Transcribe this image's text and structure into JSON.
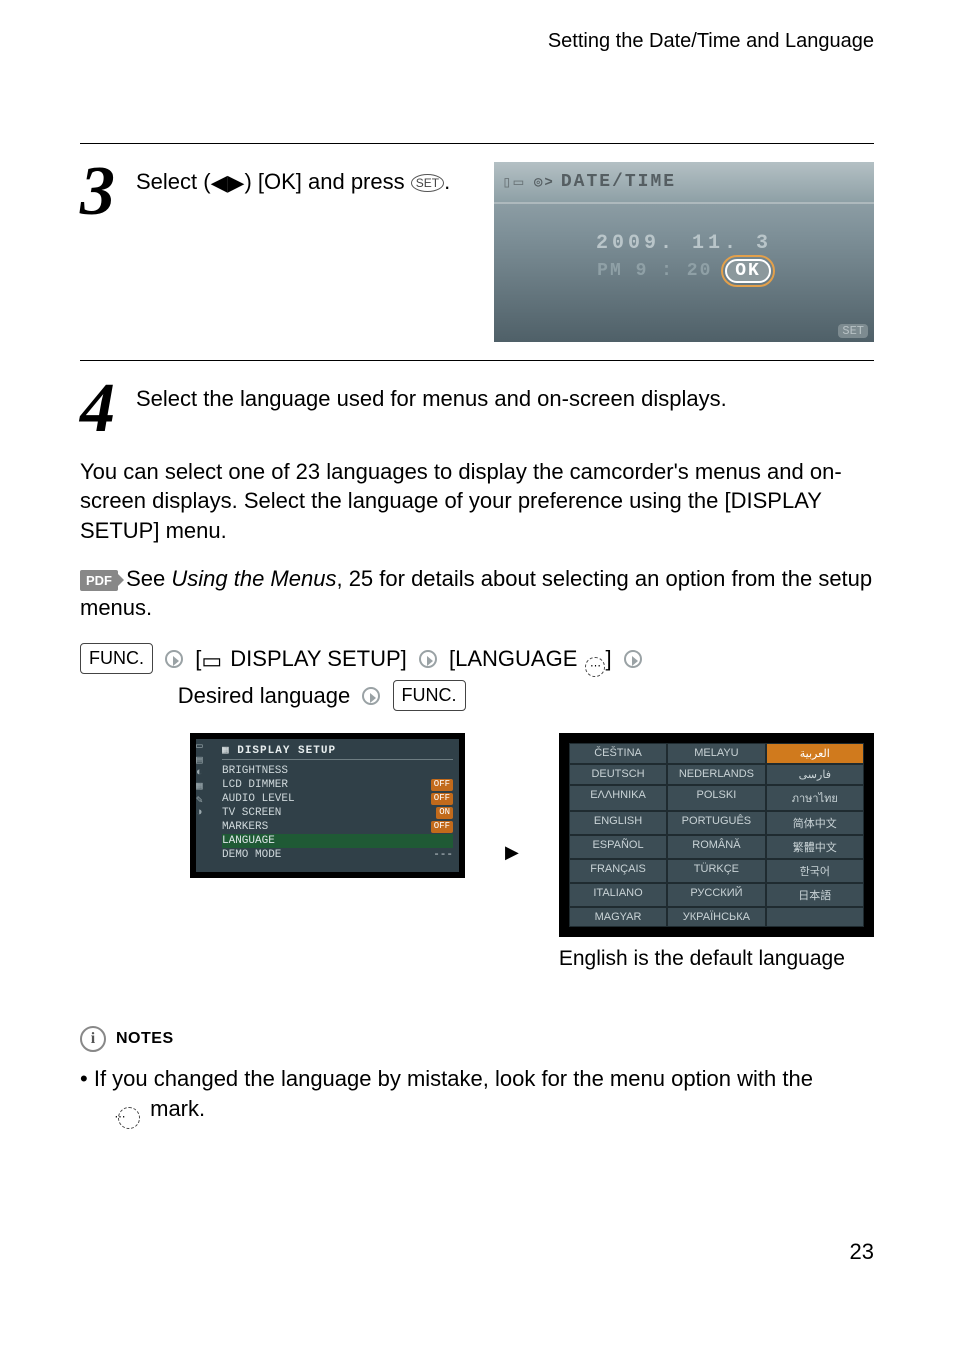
{
  "header": {
    "section_title": "Setting the Date/Time and Language"
  },
  "step3": {
    "number": "3",
    "text_pre": "Select (",
    "text_mid": ") [OK] and press ",
    "text_post": ".",
    "set_label": "SET",
    "lcd": {
      "breadcrumb": "DATE/TIME",
      "date": "2009. 11.  3",
      "time_prefix": "PM  9 : 20",
      "ok": "OK",
      "set_corner": "SET"
    }
  },
  "step4": {
    "number": "4",
    "text": "Select the language used for menus and on-screen displays."
  },
  "para1": "You can select one of 23 languages to display the camcorder's menus and on-screen displays. Select the language of your preference using the [DISPLAY SETUP] menu.",
  "pdf_line": {
    "badge": "PDF",
    "pre": " See ",
    "link": "Using the Menus",
    "post": ", 25 for details about selecting an option from the setup menus."
  },
  "menu_path": {
    "func": "FUNC.",
    "display_setup": " DISPLAY SETUP]",
    "language": "[LANGUAGE ",
    "lang_close": "]",
    "desired": "Desired language"
  },
  "lcd2": {
    "title": "DISPLAY SETUP",
    "rows": [
      {
        "label": "BRIGHTNESS",
        "val": ""
      },
      {
        "label": "LCD DIMMER",
        "val": "OFF"
      },
      {
        "label": "AUDIO LEVEL",
        "val": "OFF"
      },
      {
        "label": "TV SCREEN",
        "val": "ON"
      },
      {
        "label": "MARKERS",
        "val": "OFF"
      },
      {
        "label": "LANGUAGE",
        "val": "",
        "hl": true
      },
      {
        "label": "DEMO MODE",
        "val": "---"
      }
    ]
  },
  "languages": [
    "ČEŠTINA",
    "MELAYU",
    "العربية",
    "DEUTSCH",
    "NEDERLANDS",
    "فارسی",
    "ΕΛΛΗΝΙΚΑ",
    "POLSKI",
    "ภาษาไทย",
    "ENGLISH",
    "PORTUGUÊS",
    "简体中文",
    "ESPAÑOL",
    "ROMÂNĂ",
    "繁體中文",
    "FRANÇAIS",
    "TÜRKÇE",
    "한국어",
    "ITALIANO",
    "РУССКИЙ",
    "日本語",
    "MAGYAR",
    "УКРАЇНСЬКА",
    ""
  ],
  "caption": "English is the default language",
  "notes": {
    "title": "NOTES",
    "bullet1_pre": "If you changed the language by mistake, look for the menu option with the ",
    "bullet1_post": " mark."
  },
  "page_number": "23"
}
